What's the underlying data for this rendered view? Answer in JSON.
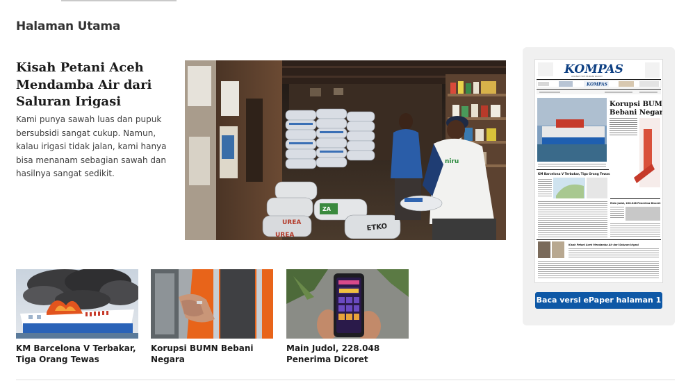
{
  "section": {
    "title": "Halaman Utama"
  },
  "headline": {
    "title": "Kisah Petani Aceh Mendamba Air dari Saluran Irigasi",
    "summary": "Kami punya sawah luas dan pupuk bersubsidi sangat cukup. Namun, kalau irigasi tidak jalan, kami hanya bisa menanam sebagian sawah dan hasilnya sangat sedikit."
  },
  "hero_image": {
    "sack_labels": [
      "UREA",
      "UREA",
      "ZA",
      "ETKO"
    ],
    "vest_label": "niru"
  },
  "cards": [
    {
      "caption": "KM Barcelona V Terbakar, Tiga Orang Tewas"
    },
    {
      "caption": "Korupsi BUMN Bebani Negara"
    },
    {
      "caption": "Main Judol, 228.048 Penerima Dicoret"
    }
  ],
  "epaper": {
    "masthead": "KOMPAS",
    "tagline": "AMANAT HATI NURANI RAKYAT",
    "main_headline_1": "Korupsi BUMN",
    "main_headline_2": "Bebani Negara",
    "story_1": "KM Barcelona V Terbakar, Tiga Orang Tewas",
    "story_2": "Main Judol, 228.048 Penerima Dicoret",
    "story_3": "Kisah Petani Aceh Mendamba Air dari Saluran Irigasi",
    "button_label": "Baca versi ePaper halaman 1"
  },
  "colors": {
    "accent": "#0e58a6",
    "panel_bg": "#f0f0f0",
    "masthead": "#0d3f82"
  }
}
